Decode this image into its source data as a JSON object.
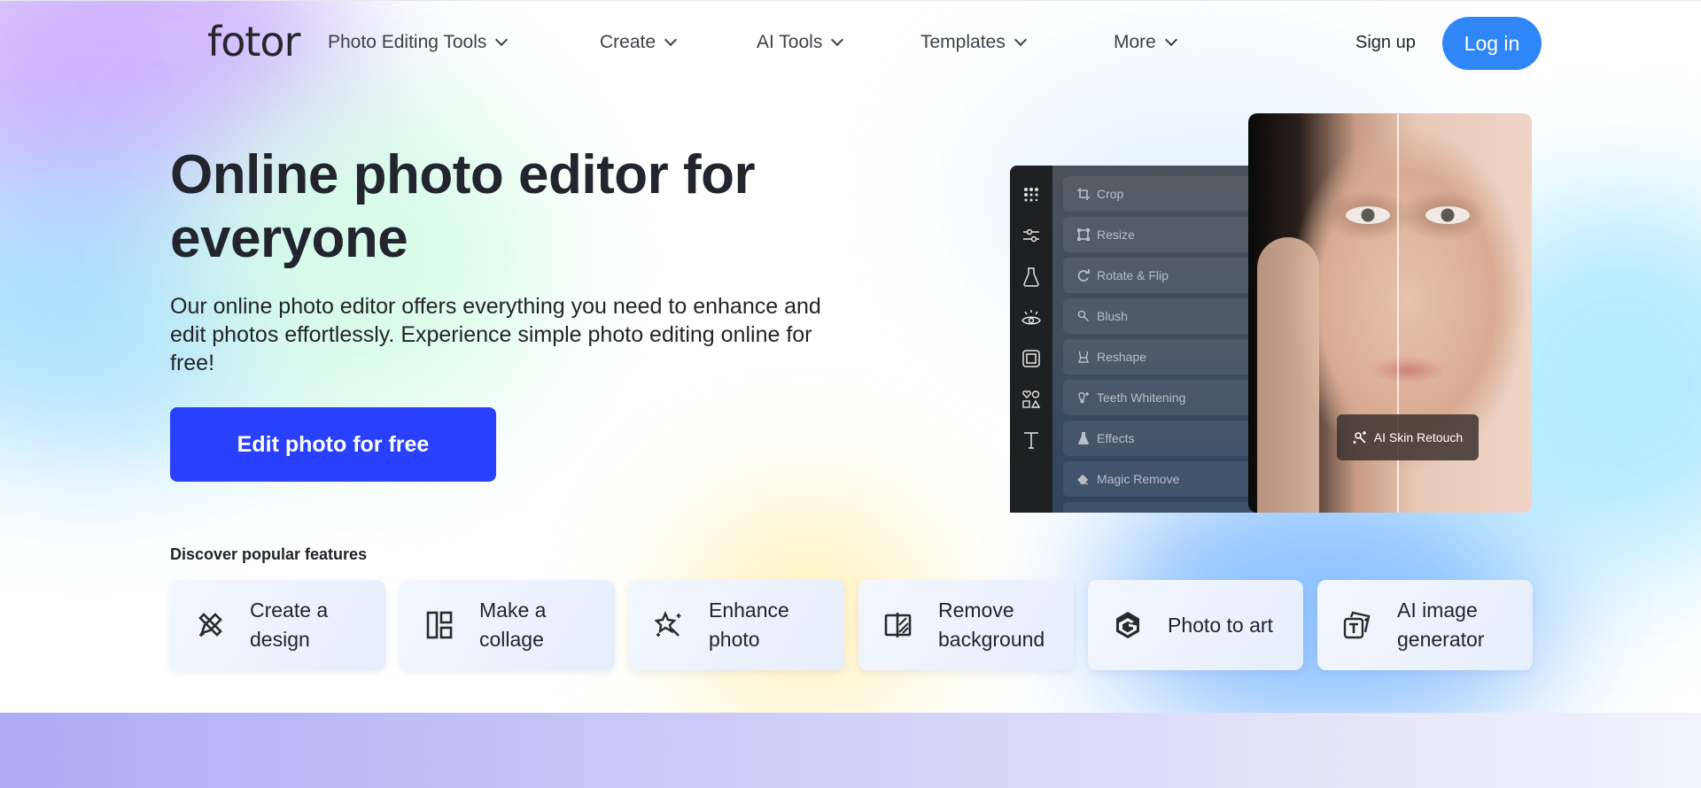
{
  "brand": {
    "name": "fotor",
    "logo_icon": "color-wheel-icon"
  },
  "nav": {
    "items": [
      {
        "label": "Photo Editing Tools",
        "icon": "chevron-down-icon"
      },
      {
        "label": "Create",
        "icon": "chevron-down-icon"
      },
      {
        "label": "AI Tools",
        "icon": "chevron-down-icon"
      },
      {
        "label": "Templates",
        "icon": "chevron-down-icon"
      },
      {
        "label": "More",
        "icon": "chevron-down-icon"
      }
    ],
    "signup_label": "Sign up",
    "login_label": "Log in"
  },
  "hero": {
    "headline": "Online photo editor for everyone",
    "subtext": "Our online photo editor offers everything you need to enhance and edit photos effortlessly. Experience simple photo editing online for free!",
    "cta_label": "Edit photo for free"
  },
  "editor_preview": {
    "rail_icons": [
      "grid-icon",
      "sliders-icon",
      "flask-icon",
      "eye-icon",
      "frame-icon",
      "shapes-icon",
      "text-icon"
    ],
    "tools": [
      {
        "label": "Crop",
        "icon": "crop-icon"
      },
      {
        "label": "Resize",
        "icon": "resize-icon"
      },
      {
        "label": "Rotate & Flip",
        "icon": "rotate-icon"
      },
      {
        "label": "Blush",
        "icon": "brush-icon"
      },
      {
        "label": "Reshape",
        "icon": "reshape-icon"
      },
      {
        "label": "Teeth Whitening",
        "icon": "tooth-icon"
      },
      {
        "label": "Effects",
        "icon": "flask-icon"
      },
      {
        "label": "Magic Remove",
        "icon": "eraser-icon"
      }
    ],
    "badge_label": "AI Skin Retouch",
    "badge_icon": "magic-sparkle-icon"
  },
  "features": {
    "title": "Discover popular features",
    "items": [
      {
        "label": "Create a design",
        "icon": "pencil-ruler-icon"
      },
      {
        "label": "Make a collage",
        "icon": "collage-layout-icon"
      },
      {
        "label": "Enhance photo",
        "icon": "magic-star-icon"
      },
      {
        "label": "Remove background",
        "icon": "remove-bg-icon"
      },
      {
        "label": "Photo to art",
        "icon": "hexagon-g-icon"
      },
      {
        "label": "AI image generator",
        "icon": "text-to-image-icon"
      }
    ]
  },
  "colors": {
    "primary_cta": "#2941ff",
    "login_button": "#2f86f6",
    "text_dark": "#22252d"
  }
}
